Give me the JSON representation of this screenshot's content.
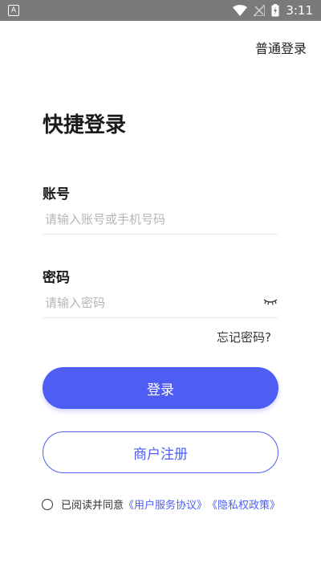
{
  "status_bar": {
    "time": "3:11",
    "left_icon": "A"
  },
  "header": {
    "normal_login_link": "普通登录"
  },
  "page": {
    "title": "快捷登录"
  },
  "form": {
    "account_label": "账号",
    "account_placeholder": "请输入账号或手机号码",
    "password_label": "密码",
    "password_placeholder": "请输入密码",
    "forgot_password": "忘记密码?"
  },
  "buttons": {
    "login": "登录",
    "register": "商户注册"
  },
  "agreement": {
    "prefix": "已阅读并同意",
    "user_agreement": "《用户服务协议》",
    "privacy_policy": "《隐私权政策》"
  },
  "colors": {
    "accent": "#4e5ef5",
    "status_bar": "#7a7a7a"
  }
}
